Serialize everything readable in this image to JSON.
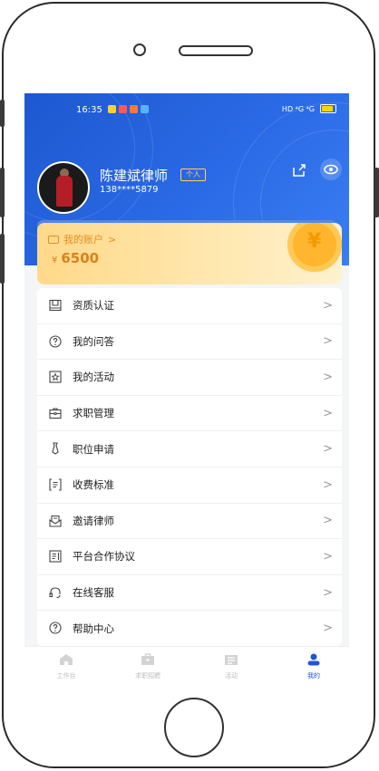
{
  "status_bar": {
    "time": "16:35",
    "network": "HD ⁴G ⁴G"
  },
  "profile": {
    "name": "陈建斌律师",
    "tag": "个人",
    "phone": "138****5879"
  },
  "account": {
    "label": "我的账户",
    "currency": "¥",
    "balance": "6500"
  },
  "menu": [
    {
      "label": "资质认证",
      "icon": "certificate-icon"
    },
    {
      "label": "我的问答",
      "icon": "question-icon"
    },
    {
      "label": "我的活动",
      "icon": "activity-icon"
    },
    {
      "label": "求职管理",
      "icon": "briefcase-icon"
    },
    {
      "label": "职位申请",
      "icon": "tie-icon"
    },
    {
      "label": "收费标准",
      "icon": "fee-icon"
    },
    {
      "label": "邀请律师",
      "icon": "invite-icon"
    },
    {
      "label": "平台合作协议",
      "icon": "agreement-icon"
    },
    {
      "label": "在线客服",
      "icon": "headset-icon"
    },
    {
      "label": "帮助中心",
      "icon": "help-icon"
    }
  ],
  "tabs": [
    {
      "label": "工作台",
      "icon": "home-icon",
      "active": false
    },
    {
      "label": "求职招聘",
      "icon": "briefcase-icon",
      "active": false
    },
    {
      "label": "活动",
      "icon": "calendar-icon",
      "active": false
    },
    {
      "label": "我的",
      "icon": "user-icon",
      "active": true
    }
  ],
  "colors": {
    "primary": "#1d58cf",
    "account_text": "#d9821a",
    "card_bg": "#ffe3a0"
  }
}
